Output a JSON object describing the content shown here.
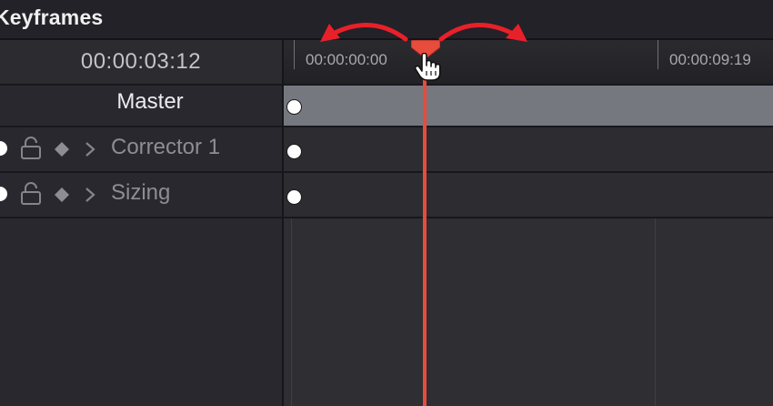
{
  "panel": {
    "title": "Keyframes"
  },
  "timecode": {
    "current": "00:00:03:12"
  },
  "ruler": {
    "labels": [
      "00:00:00:00",
      "00:00:09:19"
    ]
  },
  "tracks": [
    {
      "label": "Master"
    },
    {
      "label": "Corrector 1"
    },
    {
      "label": "Sizing"
    }
  ],
  "colors": {
    "playhead": "#e74c3c",
    "arrows": "#e8202a",
    "master_track": "#75787f"
  }
}
